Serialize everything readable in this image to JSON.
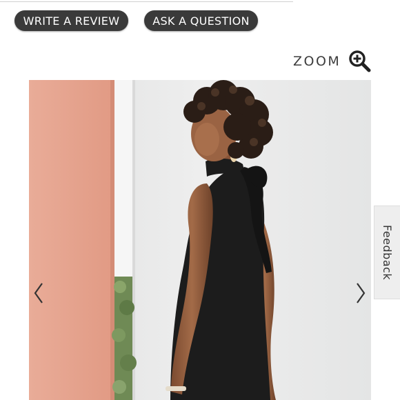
{
  "buttons": {
    "write_review_label": "WRITE A REVIEW",
    "ask_question_label": "ASK A QUESTION"
  },
  "zoom": {
    "label": "ZOOM",
    "icon": "magnifier-plus-icon"
  },
  "gallery": {
    "image_alt": "",
    "prev_icon": "chevron-left-icon",
    "next_icon": "chevron-right-icon"
  },
  "feedback": {
    "label": "Feedback"
  },
  "colors": {
    "button_bg": "#3a3a3a",
    "button_text": "#ffffff",
    "zoom_text": "#3c3c3c",
    "feedback_bg": "#eeeeee",
    "photo_wall_pink": "#e6a18c",
    "dress": "#1c1c1c"
  }
}
